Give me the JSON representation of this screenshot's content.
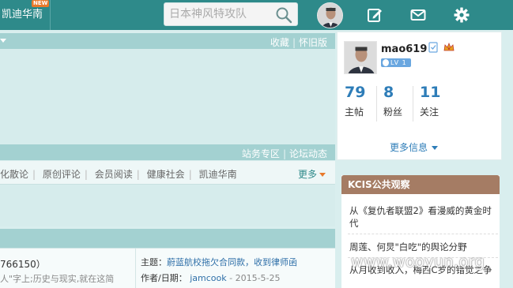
{
  "topbar": {
    "tab_label": "凯迪华南",
    "new_badge": "NEW",
    "search_placeholder": "日本神风特攻队",
    "icons": [
      "search-icon",
      "user-avatar",
      "compose-icon",
      "mail-icon",
      "settings-icon"
    ],
    "colors": {
      "bar": "#2e8a8a",
      "accent": "#e8792b"
    }
  },
  "banner": {
    "top_links": [
      "收藏",
      "怀旧版"
    ],
    "bottom_links": [
      "站务专区",
      "论坛动态"
    ]
  },
  "categories": {
    "items": [
      "化散论",
      "原创评论",
      "会员阅读",
      "健康社会",
      "凯迪华南"
    ],
    "more_label": "更多"
  },
  "content": {
    "left_line1": "766150）",
    "left_line2": "人\"字上;历史与现实,就在这简",
    "topic_label": "主题：",
    "topic_value": "蔚蓝航校拖欠合同款，收到律师函",
    "author_label": "作者/日期：",
    "author_value": "jamcook",
    "date_value": "- 2015-5-25"
  },
  "user_card": {
    "username": "mao619",
    "level": "LV 1",
    "stats": [
      {
        "num": "79",
        "label": "主帖"
      },
      {
        "num": "8",
        "label": "粉丝"
      },
      {
        "num": "11",
        "label": "关注"
      }
    ],
    "more_info": "更多信息"
  },
  "kcis": {
    "title": "KCIS公共观察",
    "items": [
      "从《复仇者联盟2》看漫威的黄金时代",
      "周莲、何炅\"白吃\"的舆论分野",
      "从月收到收入，梅西C罗的错觉之争"
    ]
  },
  "watermark": "www.wooyun.org"
}
